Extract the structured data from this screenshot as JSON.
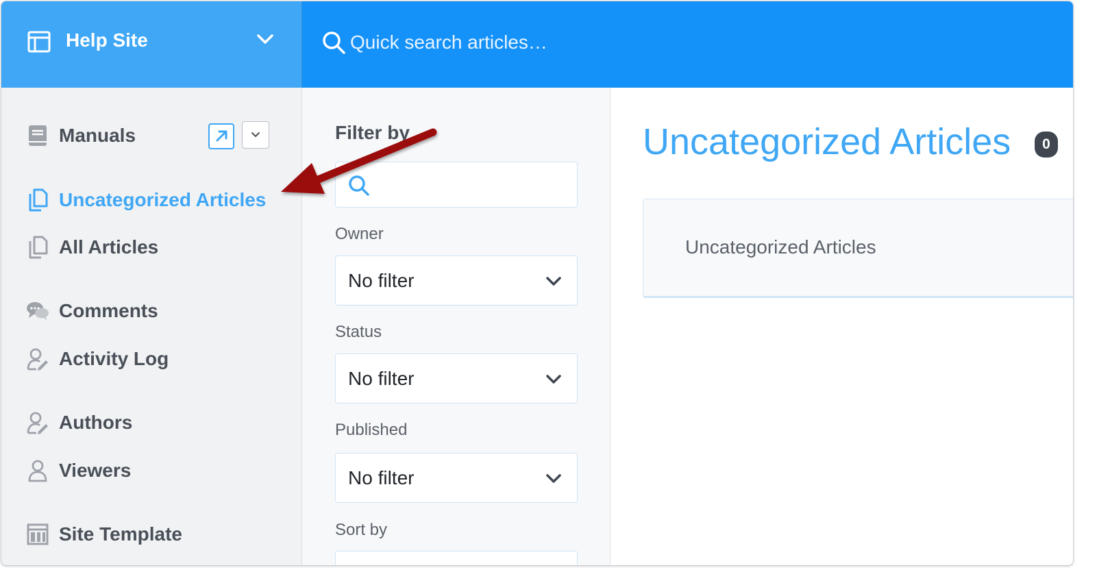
{
  "header": {
    "site_name": "Help Site",
    "search_placeholder": "Quick search articles…"
  },
  "sidebar": {
    "manuals_label": "Manuals",
    "items": [
      {
        "label": "Uncategorized Articles",
        "icon": "documents-icon",
        "active": true
      },
      {
        "label": "All Articles",
        "icon": "documents-icon",
        "active": false
      },
      {
        "label": "Comments",
        "icon": "comments-icon",
        "active": false
      },
      {
        "label": "Activity Log",
        "icon": "user-edit-icon",
        "active": false
      },
      {
        "label": "Authors",
        "icon": "user-edit-icon",
        "active": false
      },
      {
        "label": "Viewers",
        "icon": "user-icon",
        "active": false
      },
      {
        "label": "Site Template",
        "icon": "template-icon",
        "active": false
      }
    ]
  },
  "filter": {
    "title": "Filter by",
    "search_value": "",
    "owner_label": "Owner",
    "owner_value": "No filter",
    "status_label": "Status",
    "status_value": "No filter",
    "published_label": "Published",
    "published_value": "No filter",
    "sort_label": "Sort by"
  },
  "main": {
    "title": "Uncategorized Articles",
    "count": "0",
    "card_text": "Uncategorized Articles"
  },
  "colors": {
    "accent": "#3fa7f5",
    "topbar": "#1592f9",
    "annotation_arrow": "#9b0a0d"
  }
}
